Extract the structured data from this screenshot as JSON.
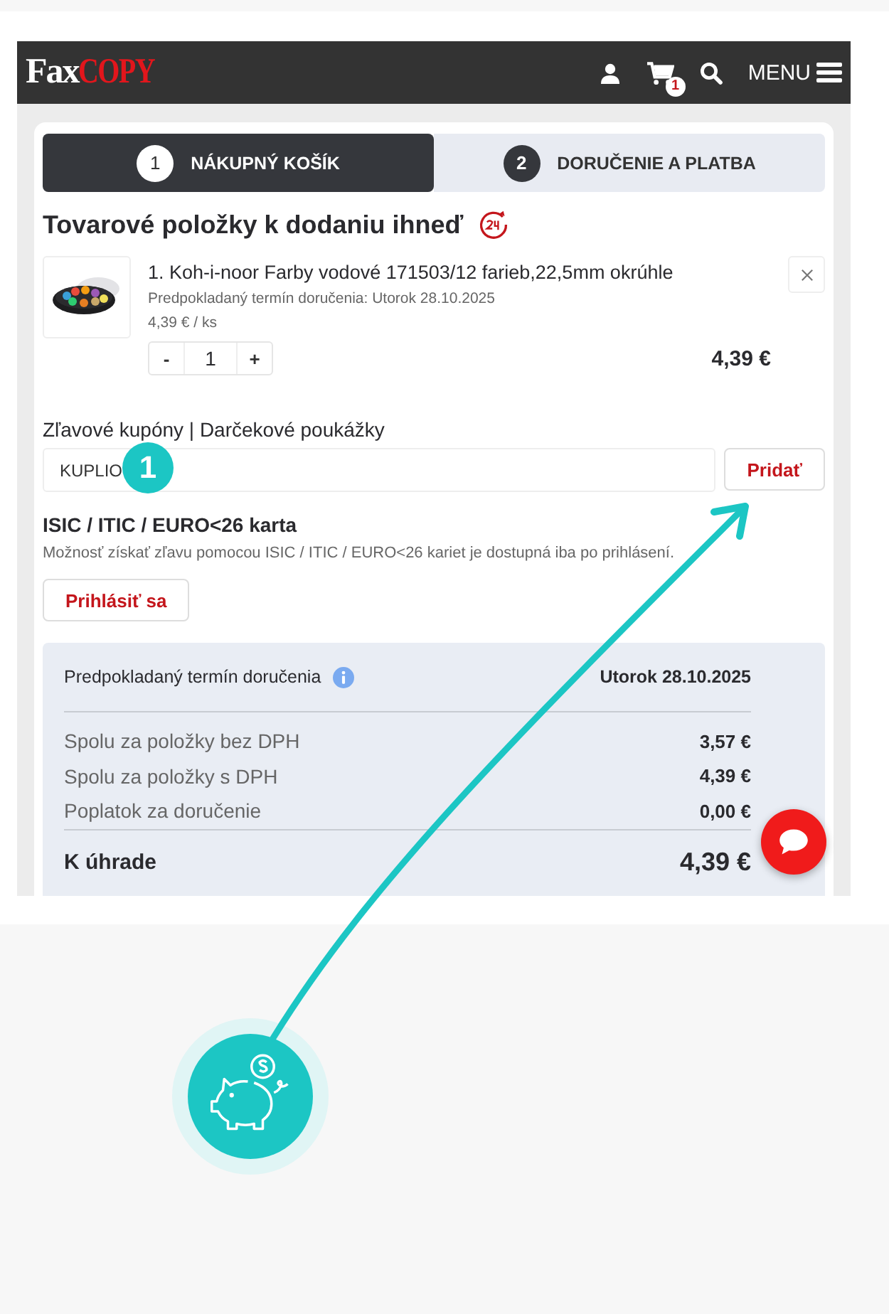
{
  "header": {
    "logo_primary": "Fax",
    "logo_secondary": "COPY",
    "cart_count": "1",
    "menu_label": "MENU"
  },
  "steps": [
    {
      "number": "1",
      "label": "NÁKUPNÝ KOŠÍK",
      "selected": true
    },
    {
      "number": "2",
      "label": "DORUČENIE A PLATBA",
      "selected": false
    }
  ],
  "section_title": "Tovarové položky k dodaniu ihneď",
  "items": [
    {
      "title": "1. Koh-i-noor Farby vodové 171503/12 farieb,22,5mm okrúhle",
      "delivery": "Predpokladaný termín doručenia: Utorok 28.10.2025",
      "unit_price": "4,39 € / ks",
      "minus": "-",
      "quantity": "1",
      "plus": "+",
      "total": "4,39 €"
    }
  ],
  "coupon": {
    "label": "Zľavové kupóny | Darčekové poukážky",
    "value": "KUPLIO",
    "button": "Pridať",
    "marker": "1"
  },
  "isic": {
    "title": "ISIC / ITIC / EURO<26 karta",
    "text": "Možnosť získať zľavu pomocou ISIC / ITIC / EURO<26 kariet je dostupná iba po prihlásení.",
    "button": "Prihlásiť sa"
  },
  "summary": {
    "delivery_label": "Predpokladaný termín doručenia",
    "delivery_date": "Utorok 28.10.2025",
    "rows": [
      {
        "label": "Spolu za položky bez DPH",
        "value": "3,57 €"
      },
      {
        "label": "Spolu za položky s DPH",
        "value": "4,39 €"
      },
      {
        "label": "Poplatok za doručenie",
        "value": "0,00 €"
      }
    ],
    "total_label": "K úhrade",
    "total_value": "4,39 €"
  }
}
